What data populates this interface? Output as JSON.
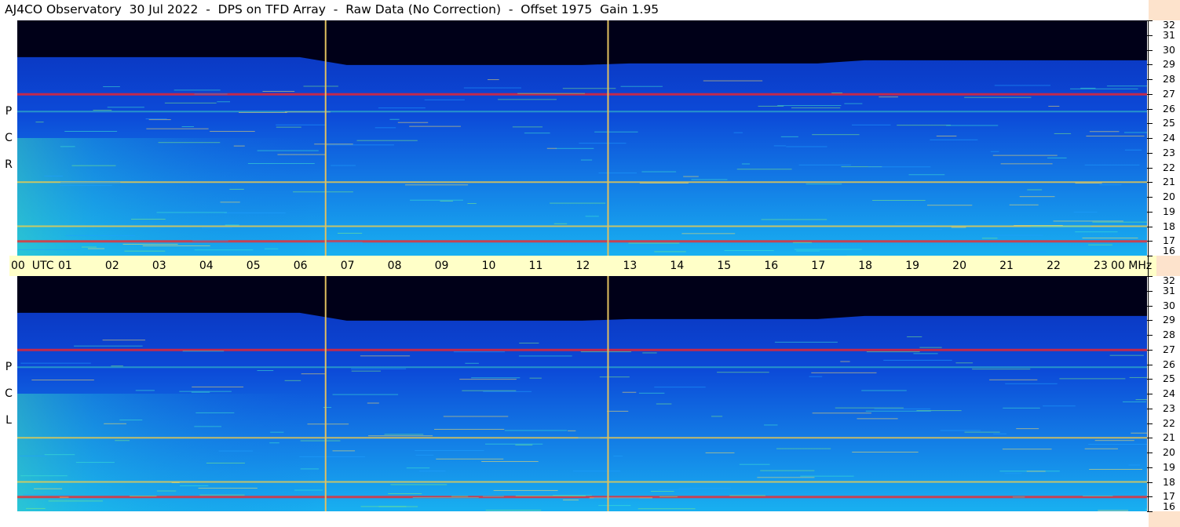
{
  "title": "AJ4CO Observatory  30 Jul 2022  -  DPS on TFD Array  -  Raw Data (No Correction)  -  Offset 1975  Gain 1.95",
  "panels": [
    {
      "id": "rcp",
      "label_letters": [
        "P",
        "C",
        "R"
      ]
    },
    {
      "id": "lcp",
      "label_letters": [
        "P",
        "C",
        "L"
      ]
    }
  ],
  "colors": {
    "background_spectrum": "#0a3fcf",
    "sky_band": "#0000a0",
    "rfi_hot": "#ff2020",
    "rfi_warm": "#ffd040",
    "time_axis_bg": "#ffffc8",
    "edge_bg": "#fde3cc",
    "cal_marker": "#e0c060"
  },
  "chart_data": {
    "type": "heatmap",
    "title": "AJ4CO Observatory  30 Jul 2022  -  DPS on TFD Array  -  Raw Data (No Correction)  -  Offset 1975  Gain 1.95",
    "xlabel": "UTC",
    "ylabel": "MHz",
    "x_ticks": [
      "00",
      "01",
      "02",
      "03",
      "04",
      "05",
      "06",
      "07",
      "08",
      "09",
      "10",
      "11",
      "12",
      "13",
      "14",
      "15",
      "16",
      "17",
      "18",
      "19",
      "20",
      "21",
      "22",
      "23",
      "00"
    ],
    "x_tick_first": "00  UTC",
    "x_tick_last": "00 MHz",
    "xlim_hours": [
      0,
      24
    ],
    "y_ticks": [
      "32",
      "31",
      "30",
      "29",
      "28",
      "27",
      "26",
      "25",
      "24",
      "23",
      "22",
      "21",
      "20",
      "19",
      "18",
      "17",
      "16"
    ],
    "ylim_mhz": [
      16,
      32
    ],
    "panels": [
      "RCP",
      "LCP"
    ],
    "calibration_markers_utc": [
      6.55,
      12.55
    ],
    "sky_cutoff_mhz": 29.5,
    "rfi_bands_mhz": [
      {
        "mhz": 27.0,
        "intensity": "high"
      },
      {
        "mhz": 21.0,
        "intensity": "medium"
      },
      {
        "mhz": 17.0,
        "intensity": "high"
      },
      {
        "mhz": 18.0,
        "intensity": "medium"
      },
      {
        "mhz": 25.8,
        "intensity": "low"
      }
    ]
  }
}
